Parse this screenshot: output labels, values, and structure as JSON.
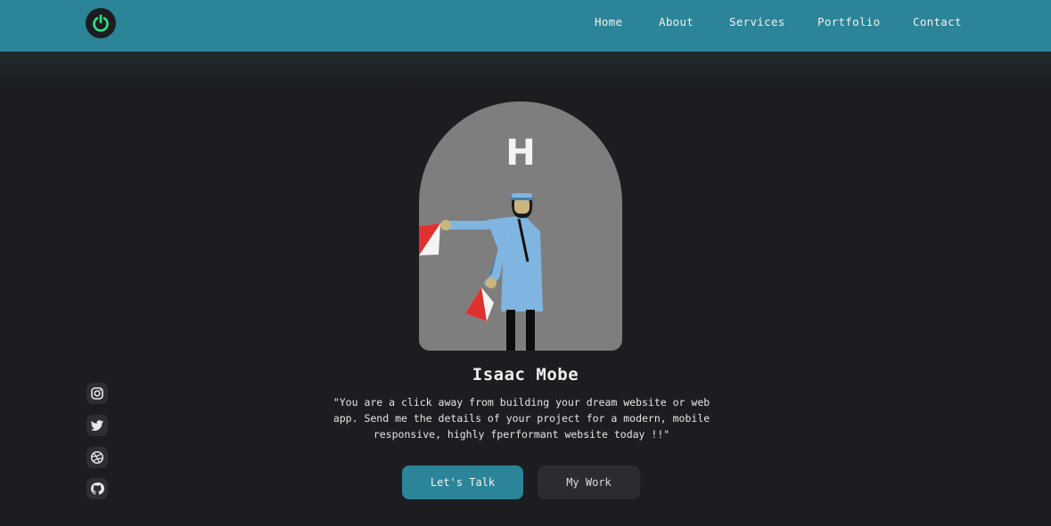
{
  "nav": {
    "logo": "power-icon",
    "links": [
      "Home",
      "About",
      "Services",
      "Portfolio",
      "Contact"
    ]
  },
  "hero": {
    "avatar_letter": "H",
    "name": "Isaac Mobe",
    "tagline": "\"You are a click away from building your dream website or web app. Send me the details of your project for a modern, mobile responsive, highly fperformant website today !!\"",
    "primary_button": "Let's Talk",
    "secondary_button": "My Work"
  },
  "social": [
    "instagram-icon",
    "twitter-icon",
    "dribbble-icon",
    "github-icon"
  ],
  "colors": {
    "header": "#2b8497",
    "background": "#1b1d20",
    "accent": "#2b8497",
    "logo_glow": "#2ee38a"
  }
}
